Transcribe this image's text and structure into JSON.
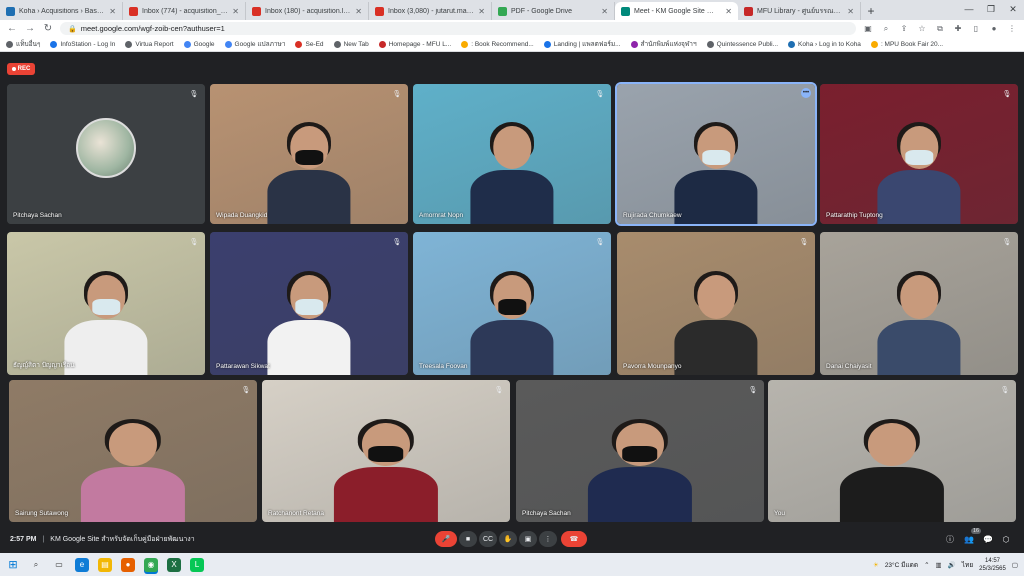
{
  "browser": {
    "tabs": [
      {
        "label": "Koha › Acquisitions › Basket PO",
        "color": "#1f6fb2",
        "active": false
      },
      {
        "label": "Inbox (774) - acquisition_library",
        "color": "#d93025",
        "active": false
      },
      {
        "label": "Inbox (180) - acquisition.library",
        "color": "#d93025",
        "active": false
      },
      {
        "label": "Inbox (3,080) - jutarut.mai@mfu",
        "color": "#d93025",
        "active": false
      },
      {
        "label": "PDF - Google Drive",
        "color": "#34a853",
        "active": false
      },
      {
        "label": "Meet - KM Google Site สำหรับ",
        "color": "#00897b",
        "active": true
      },
      {
        "label": "MFU Library - ศูนย์บรรณสารสนเทศ",
        "color": "#c62828",
        "active": false
      }
    ],
    "new_tab": "+",
    "url": "meet.google.com/wgf-zoib-cen?authuser=1",
    "bookmarks": [
      {
        "label": "แท็บอื่นๆ",
        "color": "#5f6368"
      },
      {
        "label": "InfoStation - Log In",
        "color": "#1a73e8"
      },
      {
        "label": "Virtua Report",
        "color": "#5f6368"
      },
      {
        "label": "Google",
        "color": "#4285f4"
      },
      {
        "label": "Google แปลภาษา",
        "color": "#4285f4"
      },
      {
        "label": "Se-Ed",
        "color": "#d93025"
      },
      {
        "label": "New Tab",
        "color": "#5f6368"
      },
      {
        "label": "Homepage - MFU L...",
        "color": "#c62828"
      },
      {
        "label": ": Book Recommend...",
        "color": "#f9ab00"
      },
      {
        "label": "Landing | แพลตฟอร์ม...",
        "color": "#1a73e8"
      },
      {
        "label": "สำนักพิมพ์แห่งจุฬาฯ",
        "color": "#8e24aa"
      },
      {
        "label": "Quintessence Publi...",
        "color": "#5f6368"
      },
      {
        "label": "Koha › Log in to Koha",
        "color": "#1f6fb2"
      },
      {
        "label": ": MPU Book Fair 20...",
        "color": "#f9ab00"
      }
    ]
  },
  "meet": {
    "rec_label": "REC",
    "participants": [
      {
        "name": "Pitchaya Sachan",
        "bg": "#3c4043",
        "avatar": true,
        "mask": false
      },
      {
        "name": "Wipada Duangkid",
        "bg": "#b89272",
        "mask": true,
        "body": "#2a3346"
      },
      {
        "name": "Amornrat Nopn",
        "bg": "#5fb0c9",
        "mask": false,
        "body": "#1f2d4a"
      },
      {
        "name": "Rujirada Chumkaew",
        "bg": "#9aa3ad",
        "mask": true,
        "body": "#1d2a44",
        "active": true
      },
      {
        "name": "Pattarathip Tuptong",
        "bg": "#7a1f2e",
        "mask": true,
        "body": "#3a4770"
      },
      {
        "name": "ธัญญ์สิตา ปัญญาเรือน",
        "bg": "#c9c7a8",
        "mask": true,
        "body": "#eeeeee"
      },
      {
        "name": "Pattarawan Sikwat",
        "bg": "#3b3f6e",
        "mask": true,
        "body": "#f2f2f2"
      },
      {
        "name": "Treesala Foovan",
        "bg": "#7fb4d6",
        "mask": true,
        "body": "#2d3958"
      },
      {
        "name": "Pavorra Mounpanyo",
        "bg": "#a88c6d",
        "mask": false,
        "body": "#2b2b2b"
      },
      {
        "name": "Danai Chaiyasit",
        "bg": "#a8a39a",
        "mask": false,
        "body": "#3a4b6a"
      },
      {
        "name": "Sairung Sutawong",
        "bg": "#8f7b66",
        "mask": false,
        "body": "#c27aa0"
      },
      {
        "name": "Ratchanont Retana",
        "bg": "#d6d0c6",
        "mask": true,
        "body": "#8b1e2a"
      },
      {
        "name": "Pitchaya Sachan",
        "bg": "#5a5a5a",
        "mask": true,
        "body": "#1f2b50"
      },
      {
        "name": "You",
        "bg": "#b7b4ad",
        "mask": false,
        "body": "#1c1c1c"
      }
    ],
    "time": "2:57 PM",
    "separator": "|",
    "meeting_title": "KM Google Site สำหรับจัดเก็บคู่มือฝ่ายพัฒนางา",
    "participant_count": "16",
    "controls": {
      "mic": "🎤",
      "camera": "■",
      "captions": "CC",
      "raise_hand": "✋",
      "present": "▣",
      "more": "⋮",
      "leave": "☎"
    },
    "right_controls": {
      "info": "ⓘ",
      "people": "👥",
      "chat": "💬",
      "activities": "⬡",
      "host": "🔒"
    }
  },
  "taskbar": {
    "weather": "23°C มีแดด",
    "language": "ไทย",
    "time": "14:57",
    "date": "25/3/2565"
  }
}
